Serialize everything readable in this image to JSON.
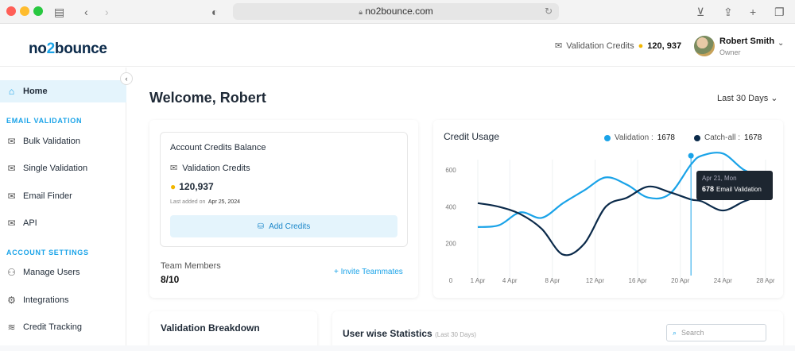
{
  "browser": {
    "url": "no2bounce.com"
  },
  "header": {
    "logo_pre": "no",
    "logo_num": "2",
    "logo_post": "bounce",
    "credits_label": "Validation Credits",
    "credits_value": "120, 937",
    "user_name": "Robert Smith",
    "user_role": "Owner"
  },
  "sidebar": {
    "home": "Home",
    "section_email": "EMAIL VALIDATION",
    "bulk": "Bulk Validation",
    "single": "Single Validation",
    "finder": "Email Finder",
    "api": "API",
    "section_account": "ACCOUNT SETTINGS",
    "users": "Manage Users",
    "integrations": "Integrations",
    "tracking": "Credit Tracking"
  },
  "main": {
    "welcome": "Welcome, Robert",
    "period": "Last 30 Days"
  },
  "balance": {
    "title": "Account Credits Balance",
    "label": "Validation Credits",
    "value": "120,937",
    "last_added_label": "Last added on",
    "last_added_date": "Apr 25, 2024",
    "add_button": "Add Credits",
    "team_label": "Team Members",
    "team_value": "8/10",
    "invite": "+ Invite Teammates"
  },
  "usage": {
    "title": "Credit Usage",
    "legend_validation": "Validation :",
    "legend_validation_value": "1678",
    "legend_catchall": "Catch-all :",
    "legend_catchall_value": "1678",
    "tooltip_date": "Apr 21, Mon",
    "tooltip_value": "678",
    "tooltip_label": "Email Validation"
  },
  "chart_data": {
    "type": "line",
    "title": "Credit Usage",
    "x_ticks": [
      "1 Apr",
      "4 Apr",
      "8 Apr",
      "12 Apr",
      "16 Apr",
      "20 Apr",
      "24 Apr",
      "28 Apr"
    ],
    "y_ticks": [
      "0",
      "200",
      "400",
      "600"
    ],
    "ylim": [
      0,
      700
    ],
    "series": [
      {
        "name": "Validation",
        "color": "#1aa3e8",
        "x": [
          1,
          3,
          5,
          7,
          9,
          11,
          13,
          15,
          17,
          19,
          21,
          22,
          24,
          26,
          28
        ],
        "values": [
          290,
          300,
          370,
          340,
          420,
          490,
          560,
          520,
          450,
          470,
          630,
          678,
          690,
          600,
          560
        ]
      },
      {
        "name": "Catch-all",
        "color": "#0b2a4a",
        "x": [
          1,
          3,
          5,
          7,
          9,
          11,
          13,
          15,
          17,
          19,
          21,
          22,
          24,
          26,
          28
        ],
        "values": [
          420,
          400,
          360,
          280,
          140,
          200,
          400,
          450,
          510,
          480,
          440,
          430,
          380,
          430,
          470
        ]
      }
    ],
    "highlight": {
      "x": 21,
      "series": "Validation",
      "value": 678
    }
  },
  "breakdown": {
    "title": "Validation Breakdown"
  },
  "userstats": {
    "title": "User wise Statistics",
    "subtitle": "(Last 30 Days)",
    "search_placeholder": "Search"
  }
}
